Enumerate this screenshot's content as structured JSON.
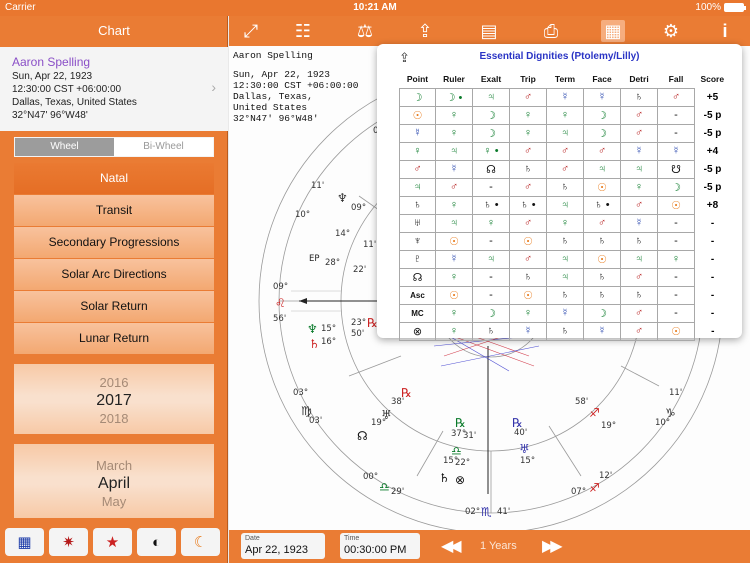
{
  "status": {
    "carrier": "Carrier",
    "time": "10:21 AM",
    "battery": "100%"
  },
  "sidebar": {
    "title": "Chart",
    "person": {
      "name": "Aaron Spelling",
      "date": "Sun, Apr 22, 1923",
      "time": "12:30:00 CST +06:00:00",
      "place": "Dallas, Texas, United States",
      "coords": "32°N47' 96°W48'"
    },
    "wheel_tabs": [
      "Wheel",
      "Bi-Wheel"
    ],
    "menu": [
      "Natal",
      "Transit",
      "Secondary Progressions",
      "Solar Arc Directions",
      "Solar Return",
      "Lunar Return"
    ],
    "year_picker": [
      "2016",
      "2017",
      "2018"
    ],
    "month_picker": [
      "March",
      "April",
      "May"
    ]
  },
  "chart": {
    "name": "Aaron Spelling",
    "date": "Sun, Apr 22, 1923",
    "time": "12:30:00 CST +06:00:00",
    "city": "Dallas, Texas,",
    "country": "United States",
    "coords": "32°N47' 96°W48'"
  },
  "wheel_labels": [
    {
      "t": "07°",
      "c": "#333"
    },
    {
      "t": "11'",
      "c": "#333"
    },
    {
      "t": "10°",
      "c": "#333"
    },
    {
      "t": "♆",
      "c": "#333"
    },
    {
      "t": "09°",
      "c": "#333"
    },
    {
      "t": "14°",
      "c": "#333"
    },
    {
      "t": "11'",
      "c": "#333"
    },
    {
      "t": "EP",
      "c": "#222"
    },
    {
      "t": "28°",
      "c": "#333"
    },
    {
      "t": "22'",
      "c": "#333"
    },
    {
      "t": "09°",
      "c": "#333"
    },
    {
      "t": "♌",
      "c": "#c22"
    },
    {
      "t": "56'",
      "c": "#333"
    },
    {
      "t": "♆",
      "c": "#0a7a2a"
    },
    {
      "t": "15°",
      "c": "#333"
    },
    {
      "t": "16°",
      "c": "#333"
    },
    {
      "t": "♄",
      "c": "#c22"
    },
    {
      "t": "23°",
      "c": "#333"
    },
    {
      "t": "50'",
      "c": "#333"
    },
    {
      "t": "℞",
      "c": "#c22"
    },
    {
      "t": "03°",
      "c": "#333"
    },
    {
      "t": "♍",
      "c": "#333"
    },
    {
      "t": "03'",
      "c": "#333"
    },
    {
      "t": "℞",
      "c": "#c22"
    },
    {
      "t": "38'",
      "c": "#333"
    },
    {
      "t": "♅",
      "c": "#333"
    },
    {
      "t": "19°",
      "c": "#333"
    },
    {
      "t": "☊",
      "c": "#111"
    },
    {
      "t": "℞",
      "c": "#0a7a2a"
    },
    {
      "t": "37°",
      "c": "#333"
    },
    {
      "t": "31'",
      "c": "#333"
    },
    {
      "t": "♎",
      "c": "#0a7a2a"
    },
    {
      "t": "15°",
      "c": "#333"
    },
    {
      "t": "22°",
      "c": "#333"
    },
    {
      "t": "♄",
      "c": "#111"
    },
    {
      "t": "⊗",
      "c": "#111"
    },
    {
      "t": "00°",
      "c": "#333"
    },
    {
      "t": "♎",
      "c": "#0a7a2a"
    },
    {
      "t": "29'",
      "c": "#333"
    },
    {
      "t": "02°",
      "c": "#333"
    },
    {
      "t": "♏",
      "c": "#33a"
    },
    {
      "t": "41'",
      "c": "#333"
    },
    {
      "t": "℞",
      "c": "#33a"
    },
    {
      "t": "40'",
      "c": "#333"
    },
    {
      "t": "♅",
      "c": "#33a"
    },
    {
      "t": "15°",
      "c": "#333"
    },
    {
      "t": "58'",
      "c": "#333"
    },
    {
      "t": "♐",
      "c": "#c22"
    },
    {
      "t": "19°",
      "c": "#333"
    },
    {
      "t": "♑",
      "c": "#333"
    },
    {
      "t": "11'",
      "c": "#333"
    },
    {
      "t": "10°",
      "c": "#333"
    },
    {
      "t": "12'",
      "c": "#333"
    },
    {
      "t": "07°",
      "c": "#333"
    },
    {
      "t": "♐",
      "c": "#c22"
    }
  ],
  "dignities": {
    "title": "Essential Dignities (Ptolemy/Lilly)",
    "columns": [
      "Point",
      "Ruler",
      "Exalt",
      "Trip",
      "Term",
      "Face",
      "Detri",
      "Fall",
      "Score"
    ],
    "colors": {
      "moon": "#0a7a2a",
      "sun": "#e87a1a",
      "venus": "#0a7a2a",
      "mars": "#b51a1a",
      "jupiter": "#0a7a2a",
      "saturn": "#111111",
      "mercury": "#1a3aa8",
      "node": "#111111",
      "other": "#111111"
    },
    "rows": [
      {
        "point": "☽",
        "cells": [
          "☽ •",
          "♃",
          "♂",
          "☿",
          "☿",
          "♄",
          "♂"
        ],
        "score": "+5"
      },
      {
        "point": "☉",
        "cells": [
          "♀",
          "☽",
          "♀",
          "♀",
          "☽",
          "♂",
          "-"
        ],
        "score": "-5 p"
      },
      {
        "point": "☿",
        "cells": [
          "♀",
          "☽",
          "♀",
          "♃",
          "☽",
          "♂",
          "-"
        ],
        "score": "-5 p"
      },
      {
        "point": "♀",
        "cells": [
          "♃",
          "♀ •",
          "♂",
          "♂",
          "♂",
          "☿",
          "☿"
        ],
        "score": "+4"
      },
      {
        "point": "♂",
        "cells": [
          "☿",
          "☊",
          "♄",
          "♂",
          "♃",
          "♃",
          "☋"
        ],
        "score": "-5 p"
      },
      {
        "point": "♃",
        "cells": [
          "♂",
          "-",
          "♂",
          "♄",
          "☉",
          "♀",
          "☽"
        ],
        "score": "-5 p"
      },
      {
        "point": "♄",
        "cells": [
          "♀",
          "♄ •",
          "♄ •",
          "♃",
          "♄ •",
          "♂",
          "☉"
        ],
        "score": "+8"
      },
      {
        "point": "♅",
        "cells": [
          "♃",
          "♀",
          "♂",
          "♀",
          "♂",
          "☿",
          "-"
        ],
        "score": "-"
      },
      {
        "point": "♆",
        "cells": [
          "☉",
          "-",
          "☉",
          "♄",
          "♄",
          "♄",
          "-"
        ],
        "score": "-"
      },
      {
        "point": "♇",
        "cells": [
          "☿",
          "♃",
          "♂",
          "♃",
          "☉",
          "♃",
          "♀"
        ],
        "score": "-"
      },
      {
        "point": "☊",
        "cells": [
          "♀",
          "-",
          "♄",
          "♃",
          "♄",
          "♂",
          "-"
        ],
        "score": "-"
      },
      {
        "point": "Asc",
        "cells": [
          "☉",
          "-",
          "☉",
          "♄",
          "♄",
          "♄",
          "-"
        ],
        "score": "-"
      },
      {
        "point": "MC",
        "cells": [
          "♀",
          "☽",
          "♀",
          "☿",
          "☽",
          "♂",
          "-"
        ],
        "score": "-"
      },
      {
        "point": "⊗",
        "cells": [
          "♀",
          "♄",
          "☿",
          "♄",
          "☿",
          "♂",
          "☉"
        ],
        "score": "-"
      }
    ]
  },
  "bottom": {
    "date_label": "Date",
    "date_value": "Apr 22, 1923",
    "time_label": "Time",
    "time_value": "00:30:00 PM",
    "step": "1 Years"
  }
}
